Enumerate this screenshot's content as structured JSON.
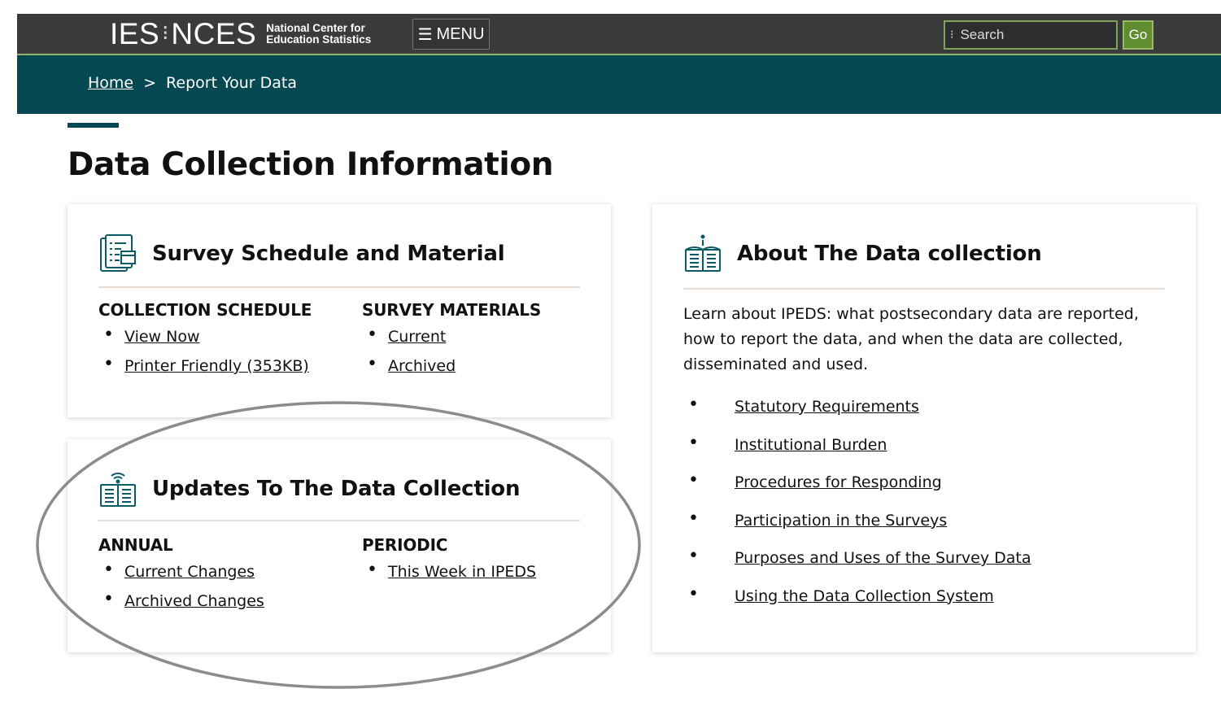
{
  "header": {
    "logo_ies": "IES",
    "logo_sep": "⁝",
    "logo_nces": "NCES",
    "logo_line1": "National Center for",
    "logo_line2": "Education Statistics",
    "menu_label": "MENU",
    "search_placeholder": "Search",
    "go_label": "Go"
  },
  "breadcrumb": {
    "home": "Home",
    "separator": ">",
    "current": "Report Your Data"
  },
  "page_title": "Data Collection Information",
  "cards": {
    "schedule": {
      "title": "Survey Schedule and Material",
      "icon": "schedule-document-icon",
      "columns": [
        {
          "heading": "COLLECTION SCHEDULE",
          "links": [
            "View Now",
            "Printer Friendly (353KB)"
          ]
        },
        {
          "heading": "SURVEY MATERIALS",
          "links": [
            "Current",
            "Archived"
          ]
        }
      ]
    },
    "updates": {
      "title": "Updates To The Data Collection",
      "icon": "book-update-icon",
      "columns": [
        {
          "heading": "ANNUAL",
          "links": [
            "Current Changes",
            "Archived Changes"
          ]
        },
        {
          "heading": "PERIODIC",
          "links": [
            "This Week in IPEDS"
          ]
        }
      ]
    },
    "about": {
      "title": "About The Data collection",
      "icon": "book-info-icon",
      "description": "Learn about IPEDS: what postsecondary data are reported, how to report the data, and when the data are collected, disseminated and used.",
      "links": [
        "Statutory Requirements",
        "Institutional Burden",
        "Procedures for Responding",
        "Participation in the Surveys",
        "Purposes and Uses of the Survey Data",
        "Using the Data Collection System"
      ]
    }
  },
  "colors": {
    "topbar": "#3b3b3b",
    "breadcrumb_bar": "#054852",
    "accent_green": "#5f8d2f",
    "icon_teal": "#0b5b66"
  }
}
